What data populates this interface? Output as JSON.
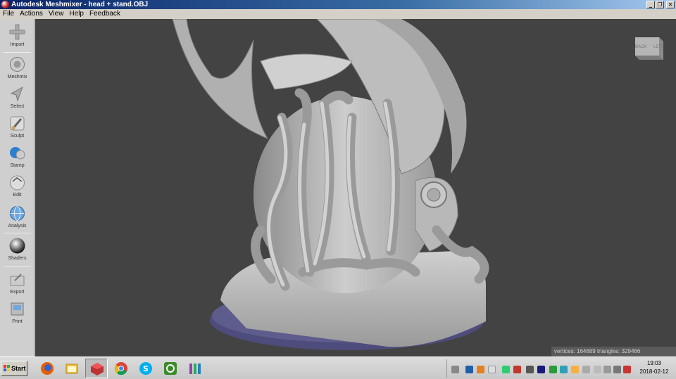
{
  "window": {
    "title": "Autodesk Meshmixer - head + stand.OBJ",
    "minimize": "_",
    "restore": "❐",
    "close": "✕"
  },
  "menu": [
    "File",
    "Actions",
    "View",
    "Help",
    "Feedback"
  ],
  "tools": [
    {
      "label": "Import",
      "icon": "plus-icon"
    },
    {
      "label": "Meshmix",
      "icon": "meshmix-icon"
    },
    {
      "label": "Select",
      "icon": "select-arrow-icon"
    },
    {
      "label": "Sculpt",
      "icon": "brush-icon"
    },
    {
      "label": "Stamp",
      "icon": "stamp-icon"
    },
    {
      "label": "Edit",
      "icon": "edit-icon"
    },
    {
      "label": "Analysis",
      "icon": "globe-icon"
    },
    {
      "label": "Shaders",
      "icon": "sphere-icon"
    },
    {
      "label": "Export",
      "icon": "export-icon"
    },
    {
      "label": "Print",
      "icon": "printer-icon"
    }
  ],
  "viewcube": {
    "back": "BACK",
    "left": "LEFT"
  },
  "stats": "vertices: 164689 triangles: 329466",
  "taskbar": {
    "start": "Start",
    "apps": [
      "firefox-icon",
      "file-explorer-icon",
      "meshmixer-icon",
      "chrome-icon",
      "skype-icon",
      "app-green-icon",
      "app-bars-icon"
    ]
  },
  "clock": {
    "time": "19:03",
    "date": "2018-02-12"
  },
  "colors": {
    "viewport": "#434343",
    "model": "#b8b8b8",
    "stand_base": "#4e4c7c"
  }
}
